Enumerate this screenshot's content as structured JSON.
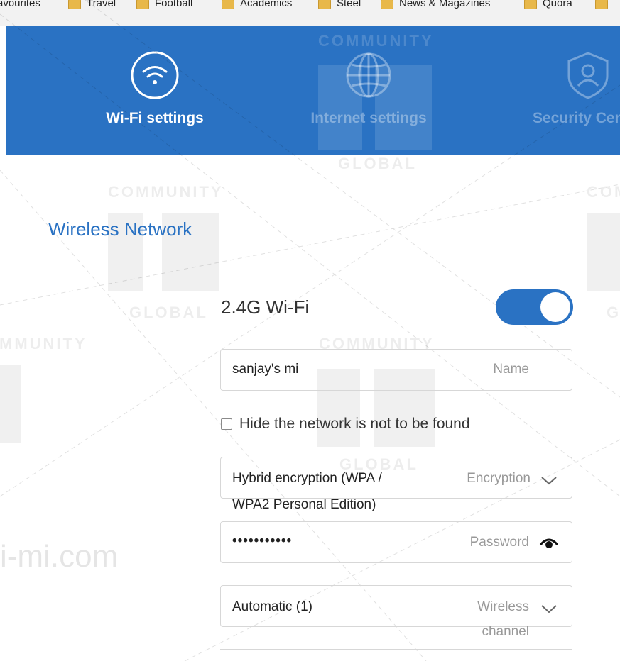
{
  "bookmarks_bar": {
    "items": [
      "avourites",
      "Travel",
      "Football",
      "Academics",
      "Steel",
      "News & Magazines",
      "Quora"
    ]
  },
  "watermark": {
    "community": "COMMUNITY",
    "global": "GLOBAL",
    "domain": "i-mi.com"
  },
  "nav": {
    "tabs": [
      {
        "label": "Wi-Fi settings",
        "icon": "wifi-icon",
        "active": true
      },
      {
        "label": "Internet settings",
        "icon": "globe-icon",
        "active": false
      },
      {
        "label": "Security Cent",
        "icon": "shield-user-icon",
        "active": false
      }
    ]
  },
  "section": {
    "title": "Wireless Network"
  },
  "wifi": {
    "band_label": "2.4G Wi-Fi",
    "enabled": true,
    "name_value": "sanjay's mi",
    "name_hint": "Name",
    "hide_network_label": "Hide the network is not to be found",
    "hide_network_checked": false,
    "encryption_value_line1": "Hybrid encryption (WPA /",
    "encryption_value_line2": "WPA2 Personal Edition)",
    "encryption_hint": "Encryption",
    "password_value": "•••••••••••",
    "password_hint": "Password",
    "channel_value": "Automatic (1)",
    "channel_hint_line1": "Wireless",
    "channel_hint_line2": "channel"
  },
  "colors": {
    "accent": "#2a72c3",
    "nav_background": "#2a72c3",
    "hint_text": "#999999",
    "field_border": "#d7d7d7"
  }
}
